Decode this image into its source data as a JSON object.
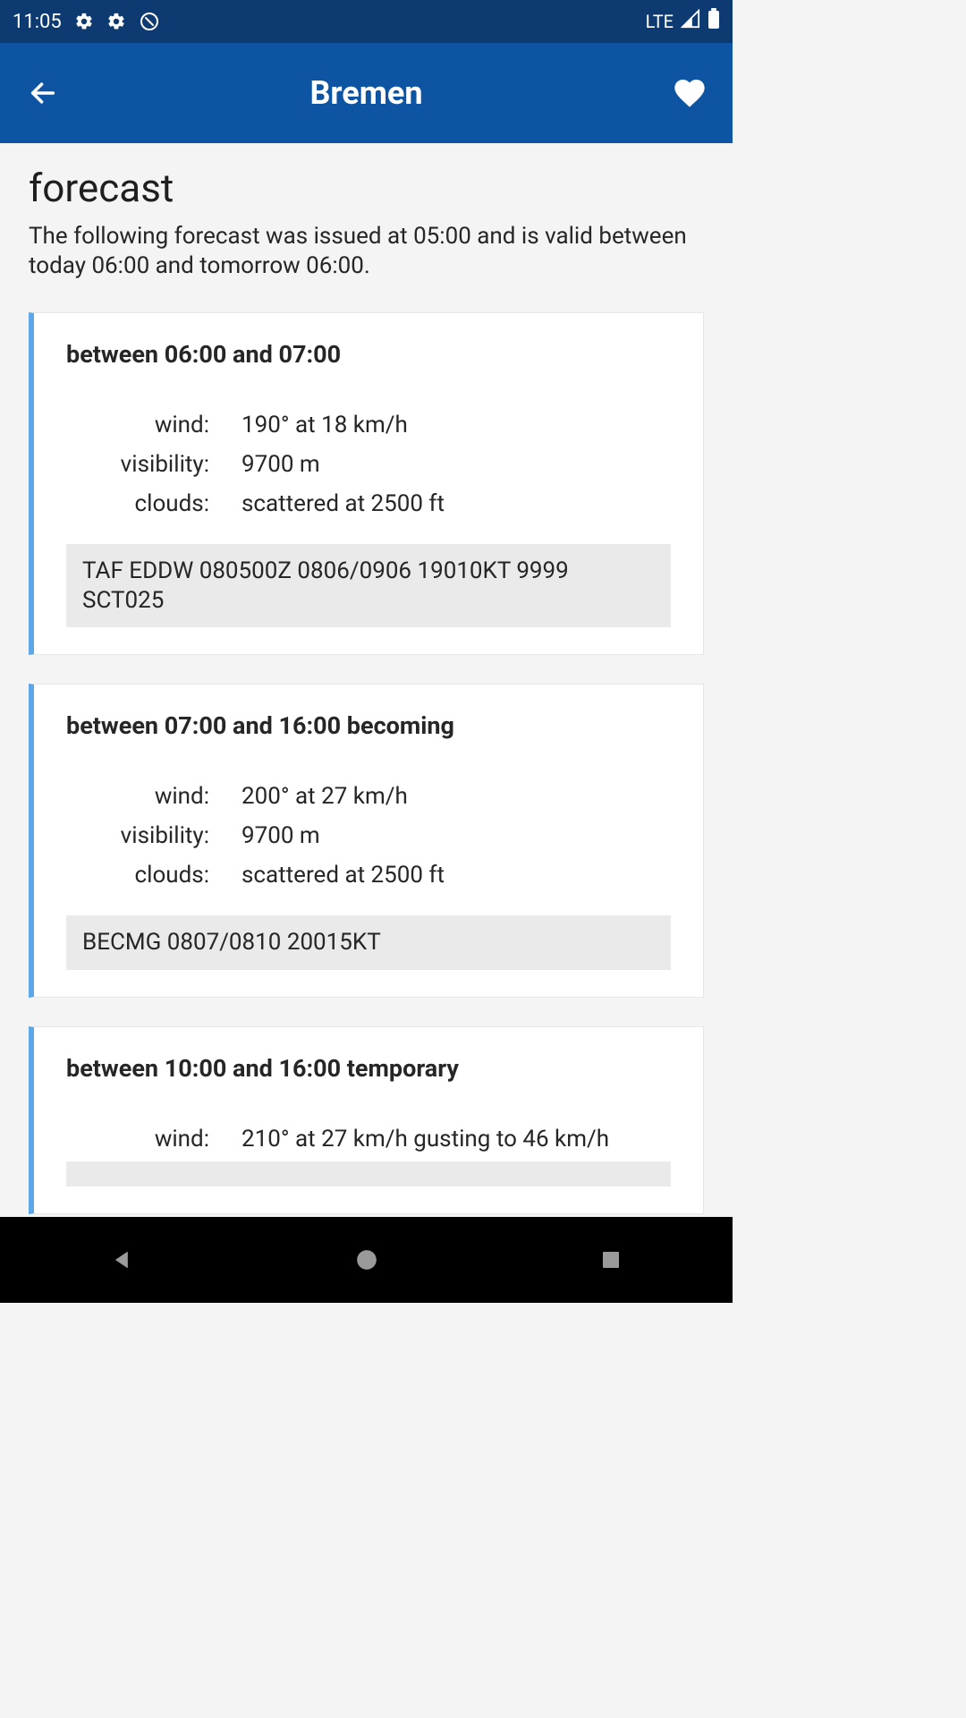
{
  "status": {
    "time": "11:05",
    "network": "LTE"
  },
  "appbar": {
    "title": "Bremen"
  },
  "page": {
    "heading": "forecast",
    "subtext": "The following forecast was issued at 05:00 and is valid between today 06:00 and tomorrow 06:00."
  },
  "labels": {
    "wind": "wind:",
    "visibility": "visibility:",
    "clouds": "clouds:"
  },
  "cards": [
    {
      "title": "between 06:00 and 07:00",
      "wind": "190° at 18 km/h",
      "visibility": "9700 m",
      "clouds": "scattered at 2500 ft",
      "raw": "TAF EDDW 080500Z 0806/0906 19010KT 9999 SCT025"
    },
    {
      "title": "between 07:00 and 16:00 becoming",
      "wind": "200° at 27 km/h",
      "visibility": "9700 m",
      "clouds": "scattered at 2500 ft",
      "raw": "BECMG 0807/0810 20015KT"
    },
    {
      "title": "between 10:00 and 16:00 temporary",
      "wind": "210° at 27 km/h gusting to 46 km/h",
      "visibility": "",
      "clouds": "",
      "raw": ""
    }
  ]
}
